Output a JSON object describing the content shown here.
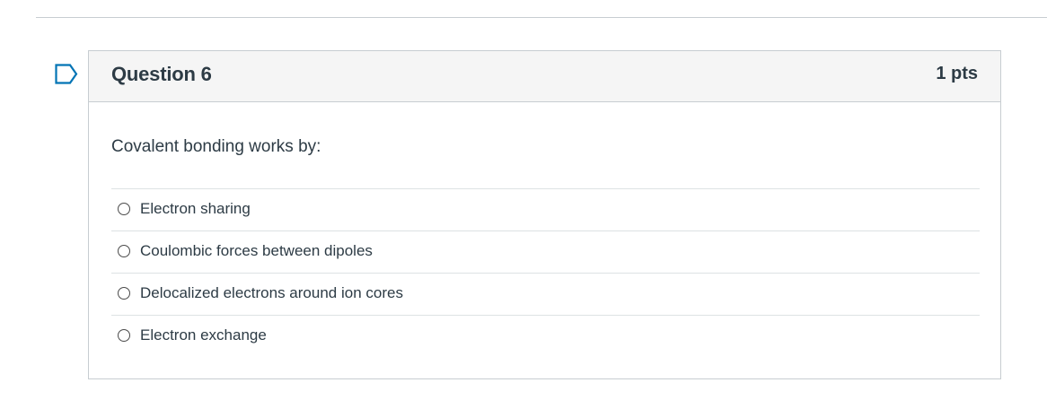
{
  "question": {
    "title": "Question 6",
    "points": "1 pts",
    "text": "Covalent bonding works by:",
    "flag_icon": "flag-outline-icon",
    "accent_color": "#0374b5"
  },
  "answers": [
    {
      "label": "Electron sharing",
      "selected": false
    },
    {
      "label": "Coulombic forces between dipoles",
      "selected": false
    },
    {
      "label": "Delocalized electrons around ion cores",
      "selected": false
    },
    {
      "label": "Electron exchange",
      "selected": false
    }
  ]
}
